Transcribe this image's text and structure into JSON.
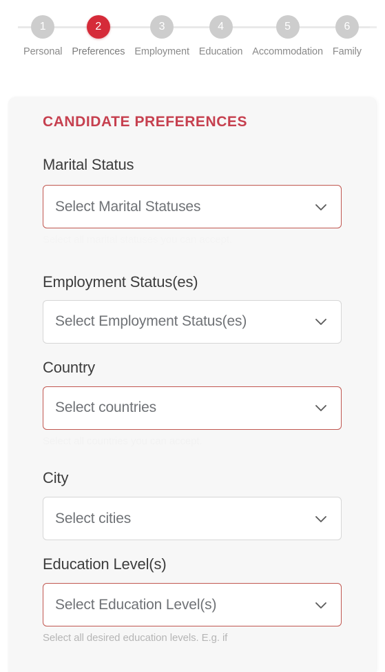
{
  "colors": {
    "page_background": "#ffffff",
    "card_background": "#f7f7f7",
    "accent_red": "#d52b39",
    "title_red": "#c6404f",
    "error_border": "#c0564f",
    "neutral_border": "#d6d6d6",
    "step_inactive": "#cdcdcd",
    "connector": "#e9e9e9",
    "placeholder_text": "#6f7276",
    "label_text": "#3c3c3c",
    "step_label_text": "#8a8a8a"
  },
  "stepper": {
    "current_step": 2,
    "total_steps": 6,
    "steps": [
      {
        "number": "1",
        "label": "Personal",
        "active": false
      },
      {
        "number": "2",
        "label": "Preferences",
        "active": true
      },
      {
        "number": "3",
        "label": "Employment",
        "active": false
      },
      {
        "number": "4",
        "label": "Education",
        "active": false
      },
      {
        "number": "5",
        "label": "Accommodation",
        "active": false
      },
      {
        "number": "6",
        "label": "Family",
        "active": false
      }
    ]
  },
  "card": {
    "title": "CANDIDATE PREFERENCES",
    "fields": {
      "marital_status": {
        "label": "Marital Status",
        "placeholder": "Select Marital Statuses",
        "value": "",
        "hint": "Select all marital statuses you can accept.",
        "state": "error",
        "icon": "chevron-down-icon"
      },
      "employment_status": {
        "label": "Employment Status(es)",
        "placeholder": "Select Employment Status(es)",
        "value": "",
        "hint": "",
        "state": "default",
        "icon": "chevron-down-icon"
      },
      "country": {
        "label": "Country",
        "placeholder": "Select countries",
        "value": "",
        "hint": "Select all countries you can accept.",
        "state": "error",
        "icon": "chevron-down-icon"
      },
      "city": {
        "label": "City",
        "placeholder": "Select cities",
        "value": "",
        "hint": "",
        "state": "default",
        "icon": "chevron-down-icon"
      },
      "education_level": {
        "label": "Education Level(s)",
        "placeholder": "Select Education Level(s)",
        "value": "",
        "hint": "Select all desired education levels. E.g. if",
        "state": "error",
        "icon": "chevron-down-icon"
      }
    }
  }
}
